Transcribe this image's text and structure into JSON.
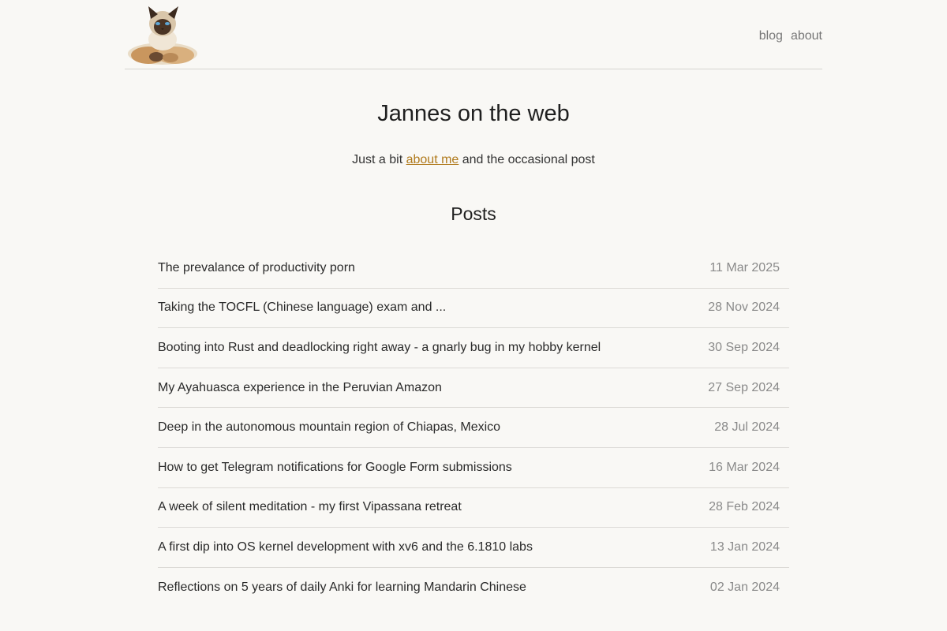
{
  "header": {
    "logo": "siamese-cat-logo",
    "nav": [
      {
        "label": "blog"
      },
      {
        "label": "about"
      }
    ]
  },
  "main": {
    "title": "Jannes on the web",
    "tagline": {
      "before": "Just a bit ",
      "link": "about me",
      "after": " and the occasional post"
    },
    "posts_heading": "Posts",
    "posts": [
      {
        "title": "The prevalance of productivity porn",
        "date": "11 Mar 2025"
      },
      {
        "title": "Taking the TOCFL (Chinese language) exam and ...",
        "date": "28 Nov 2024"
      },
      {
        "title": "Booting into Rust and deadlocking right away - a gnarly bug in my hobby kernel",
        "date": "30 Sep 2024"
      },
      {
        "title": "My Ayahuasca experience in the Peruvian Amazon",
        "date": "27 Sep 2024"
      },
      {
        "title": "Deep in the autonomous mountain region of Chiapas, Mexico",
        "date": "28 Jul 2024"
      },
      {
        "title": "How to get Telegram notifications for Google Form submissions",
        "date": "16 Mar 2024"
      },
      {
        "title": "A week of silent meditation - my first Vipassana retreat",
        "date": "28 Feb 2024"
      },
      {
        "title": "A first dip into OS kernel development with xv6 and the 6.1810 labs",
        "date": "13 Jan 2024"
      },
      {
        "title": "Reflections on 5 years of daily Anki for learning Mandarin Chinese",
        "date": "02 Jan 2024"
      }
    ]
  },
  "colors": {
    "background": "#f9f8f5",
    "link": "#b07a1c",
    "muted": "#8a8a8a"
  }
}
